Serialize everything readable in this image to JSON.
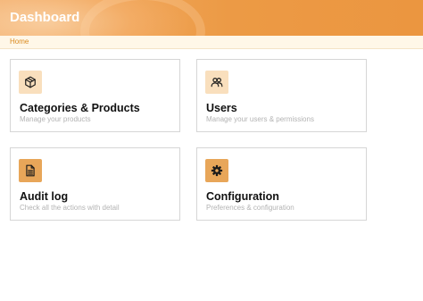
{
  "header": {
    "title": "Dashboard",
    "bg_color": "#ec9a45"
  },
  "breadcrumb": {
    "home_label": "Home"
  },
  "cards": [
    {
      "title": "Categories & Products",
      "subtitle": "Manage your products",
      "icon": "package-icon",
      "icon_bg": "#f9dfbd"
    },
    {
      "title": "Users",
      "subtitle": "Manage your users & permissions",
      "icon": "users-icon",
      "icon_bg": "#f9dfbd"
    },
    {
      "title": "Audit log",
      "subtitle": "Check  all the actions with detail",
      "icon": "document-icon",
      "icon_bg": "#e8a659"
    },
    {
      "title": "Configuration",
      "subtitle": "Preferences & configuration",
      "icon": "gear-icon",
      "icon_bg": "#e8a659"
    }
  ]
}
